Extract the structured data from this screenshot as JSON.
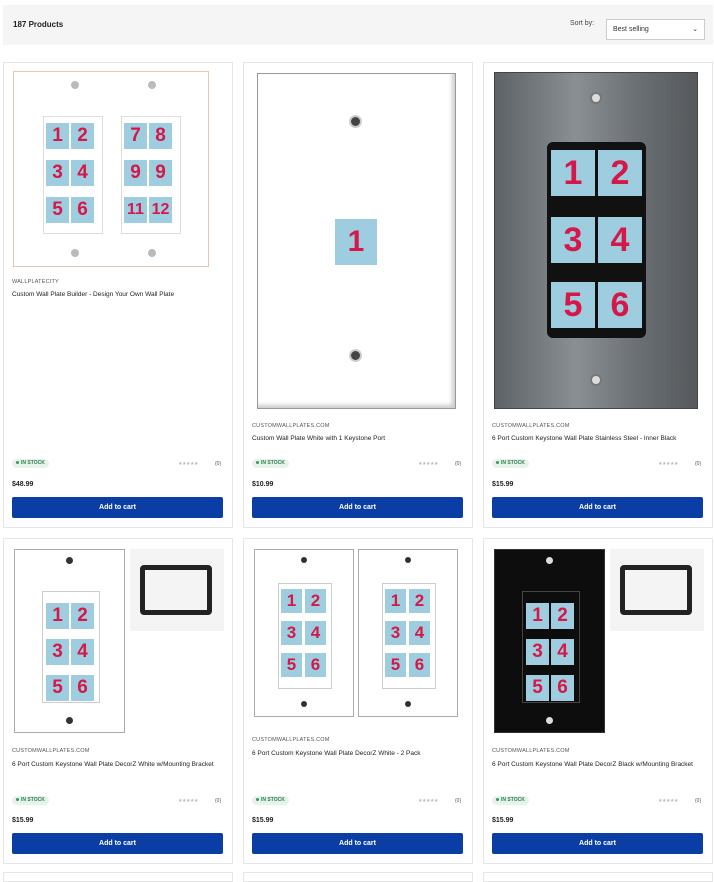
{
  "header": {
    "count": "187 Products",
    "sort_label": "Sort by:",
    "sort_value": "Best selling"
  },
  "products": [
    {
      "vendor": "WALLPLATECITY",
      "title": "Custom Wall Plate Builder - Design Your Own Wall Plate",
      "stock": "IN STOCK",
      "stars": "★★★★★",
      "reviews": "(0)",
      "price": "$48.99",
      "button": "Add to cart"
    },
    {
      "vendor": "CUSTOMWALLPLATES.COM",
      "title": "Custom Wall Plate White with 1 Keystone Port",
      "stock": "IN STOCK",
      "stars": "★★★★★",
      "reviews": "(0)",
      "price": "$10.99",
      "button": "Add to cart"
    },
    {
      "vendor": "CUSTOMWALLPLATES.COM",
      "title": "6 Port Custom Keystone Wall Plate Stainless Steel - Inner Black",
      "stock": "IN STOCK",
      "stars": "★★★★★",
      "reviews": "(0)",
      "price": "$15.99",
      "button": "Add to cart"
    },
    {
      "vendor": "CUSTOMWALLPLATES.COM",
      "title": "6 Port Custom Keystone Wall Plate DecorZ White w/Mounting Bracket",
      "stock": "IN STOCK",
      "stars": "★★★★★",
      "reviews": "(0)",
      "price": "$15.99",
      "button": "Add to cart"
    },
    {
      "vendor": "CUSTOMWALLPLATES.COM",
      "title": "6 Port Custom Keystone Wall Plate DecorZ White - 2 Pack",
      "stock": "IN STOCK",
      "stars": "★★★★★",
      "reviews": "(0)",
      "price": "$15.99",
      "button": "Add to cart"
    },
    {
      "vendor": "CUSTOMWALLPLATES.COM",
      "title": "6 Port Custom Keystone Wall Plate DecorZ Black w/Mounting Bracket",
      "stock": "IN STOCK",
      "stars": "★★★★★",
      "reviews": "(0)",
      "price": "$15.99",
      "button": "Add to cart"
    }
  ],
  "plates": {
    "builder_left": [
      "1",
      "2",
      "3",
      "4",
      "5",
      "6"
    ],
    "builder_right": [
      "7",
      "8",
      "9",
      "9",
      "11",
      "12"
    ],
    "single": [
      "1"
    ],
    "six": [
      "1",
      "2",
      "3",
      "4",
      "5",
      "6"
    ]
  },
  "colors": {
    "accent": "#0a3ea4",
    "port": "#9fcde0",
    "digit": "#d4184a"
  }
}
